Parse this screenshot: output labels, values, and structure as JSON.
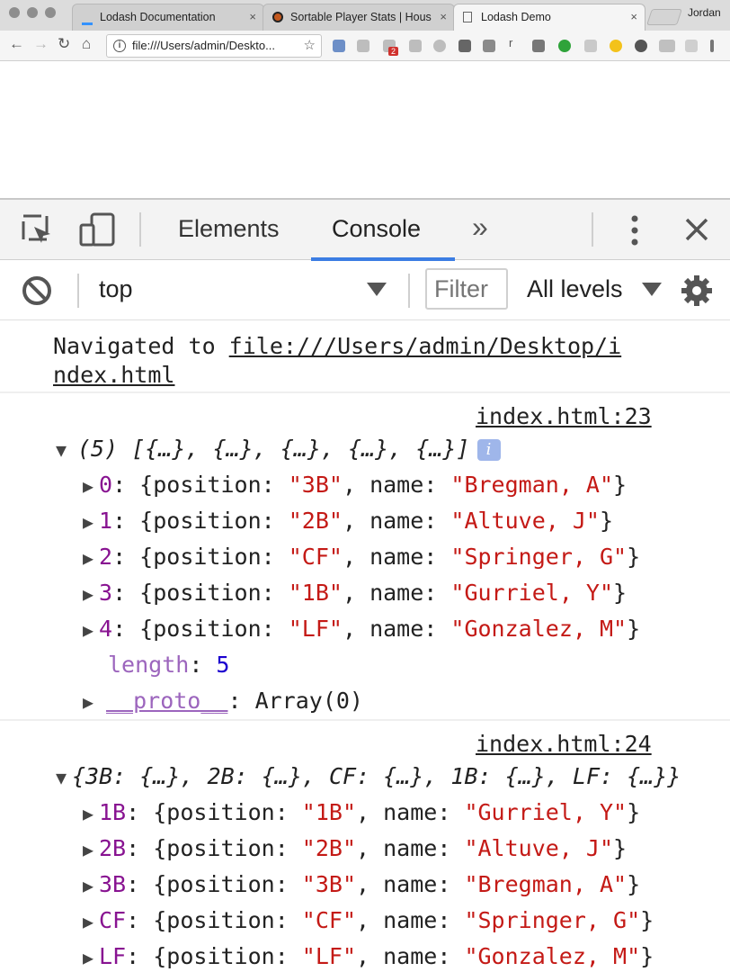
{
  "browser": {
    "tabs": [
      {
        "label": "Lodash Documentation",
        "close": "×"
      },
      {
        "label": "Sortable Player Stats | Hous",
        "close": "×"
      },
      {
        "label": "Lodash Demo",
        "close": "×"
      }
    ],
    "profile": "Jordan",
    "address": "file:///Users/admin/Deskto...",
    "ext_badge": "2"
  },
  "devtools": {
    "tabs": [
      "Elements",
      "Console"
    ],
    "more": "»",
    "context": "top",
    "filter_placeholder": "Filter",
    "levels": "All levels"
  },
  "console": {
    "nav_prefix": "Navigated to ",
    "nav_url_1": "file:///Users/admin/Desktop/i",
    "nav_url_2": "ndex.html",
    "entry1": {
      "source": "index.html:23",
      "summary": "(5) [{…}, {…}, {…}, {…}, {…}]",
      "items": [
        {
          "key": "0",
          "position": "\"3B\"",
          "name": "\"Bregman, A\""
        },
        {
          "key": "1",
          "position": "\"2B\"",
          "name": "\"Altuve, J\""
        },
        {
          "key": "2",
          "position": "\"CF\"",
          "name": "\"Springer, G\""
        },
        {
          "key": "3",
          "position": "\"1B\"",
          "name": "\"Gurriel, Y\""
        },
        {
          "key": "4",
          "position": "\"LF\"",
          "name": "\"Gonzalez, M\""
        }
      ],
      "length_label": "length",
      "length_value": "5",
      "proto_label": "__proto__",
      "proto_value": "Array(0)"
    },
    "entry2": {
      "source": "index.html:24",
      "summary": "{3B: {…}, 2B: {…}, CF: {…}, 1B: {…}, LF: {…}}",
      "items": [
        {
          "key": "1B",
          "position": "\"1B\"",
          "name": "\"Gurriel, Y\""
        },
        {
          "key": "2B",
          "position": "\"2B\"",
          "name": "\"Altuve, J\""
        },
        {
          "key": "3B",
          "position": "\"3B\"",
          "name": "\"Bregman, A\""
        },
        {
          "key": "CF",
          "position": "\"CF\"",
          "name": "\"Springer, G\""
        },
        {
          "key": "LF",
          "position": "\"LF\"",
          "name": "\"Gonzalez, M\""
        }
      ]
    },
    "words": {
      "position": "position",
      "name": "name"
    }
  }
}
